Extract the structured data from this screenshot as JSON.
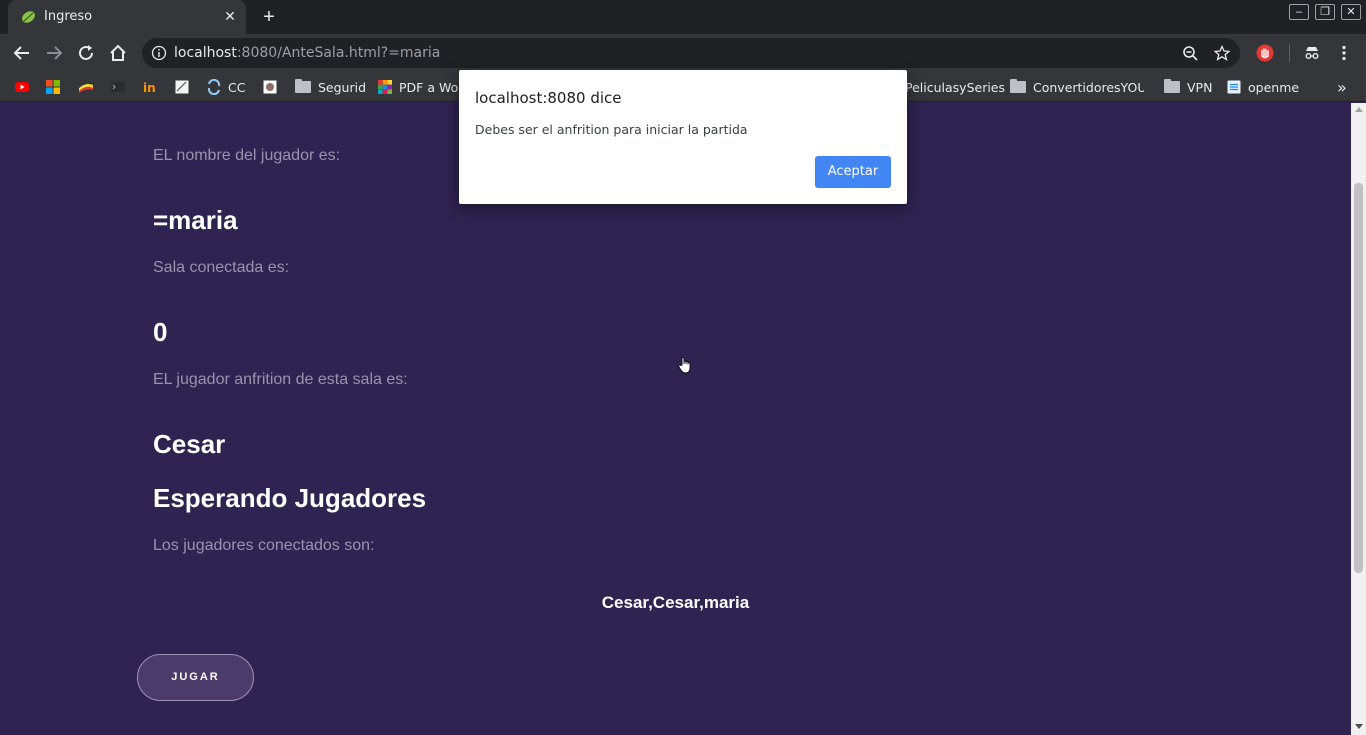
{
  "browser": {
    "tab_title": "Ingreso",
    "new_tab_symbol": "+",
    "url_host": "localhost",
    "url_rest": ":8080/AnteSala.html?=maria",
    "bookmarks": [
      {
        "label": "CC",
        "icon": "cc-icon"
      },
      {
        "label": "Segurid",
        "icon": "folder-icon"
      },
      {
        "label": "PDF a Word",
        "icon": "pdf-to-word-icon"
      },
      {
        "label": "PeliculasySeries",
        "icon": "folder-icon"
      },
      {
        "label": "ConvertidoresYOUTUBE",
        "icon": "folder-icon"
      },
      {
        "label": "VPN",
        "icon": "folder-icon"
      },
      {
        "label": "openme",
        "icon": "openme-icon"
      }
    ],
    "overflow_symbol": "»"
  },
  "page": {
    "player_label": "EL nombre del jugador es:",
    "player_name": "=maria",
    "room_label": "Sala conectada es:",
    "room_id": "0",
    "host_label": "EL jugador anfrition de esta sala es:",
    "host_name": "Cesar",
    "status": "Esperando Jugadores",
    "connected_label": "Los jugadores conectados son:",
    "connected_players": "Cesar,Cesar,maria",
    "play_button": "JUGAR"
  },
  "dialog": {
    "title": "localhost:8080 dice",
    "message": "Debes ser el anfrition para iniciar la partida",
    "ok_button": "Aceptar"
  },
  "colors": {
    "page_background": "#2f2351",
    "dialog_button": "#4285f4"
  }
}
